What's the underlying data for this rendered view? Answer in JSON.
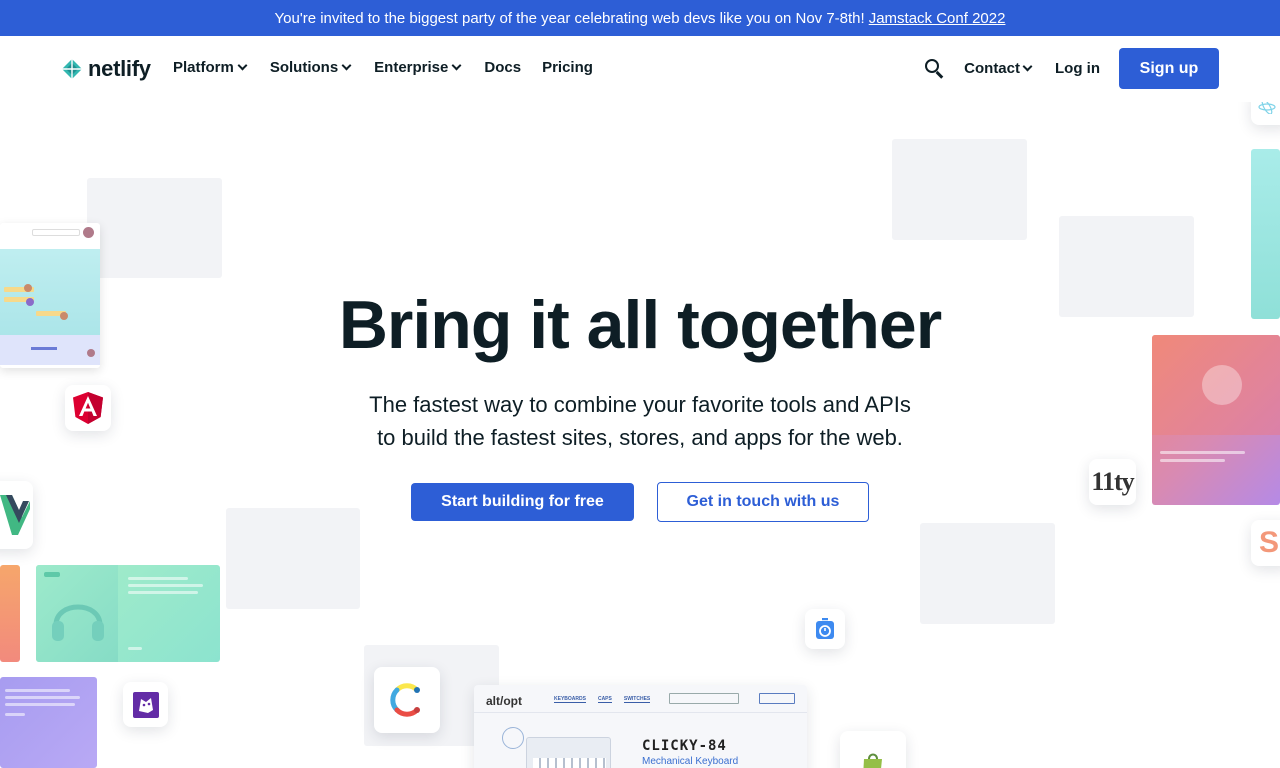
{
  "announcement": {
    "text": "You're invited to the biggest party of the year celebrating web devs like you on Nov 7-8th!",
    "link": "Jamstack Conf 2022"
  },
  "nav": {
    "logo": "netlify",
    "items": [
      {
        "label": "Platform",
        "dropdown": true
      },
      {
        "label": "Solutions",
        "dropdown": true
      },
      {
        "label": "Enterprise",
        "dropdown": true
      },
      {
        "label": "Docs",
        "dropdown": false
      },
      {
        "label": "Pricing",
        "dropdown": false
      }
    ],
    "contact": "Contact",
    "login": "Log in",
    "signup": "Sign up"
  },
  "hero": {
    "title": "Bring it all together",
    "subtitle_line1": "The fastest way to combine your favorite tools and APIs",
    "subtitle_line2": "to build the fastest sites, stores, and apps for the web.",
    "cta_primary": "Start building for free",
    "cta_secondary": "Get in touch with us"
  },
  "decor": {
    "eleventy_label": "11ty",
    "store": {
      "brand": "alt/opt",
      "links": [
        "KEYBOARDS",
        "CAPS",
        "SWITCHES"
      ],
      "title": "CLICKY-84",
      "subtitle": "Mechanical Keyboard"
    }
  },
  "colors": {
    "brand_blue": "#2d5ed6",
    "teal": "#32c7c0",
    "angular_red": "#dd0031",
    "vue_green": "#41b883"
  }
}
